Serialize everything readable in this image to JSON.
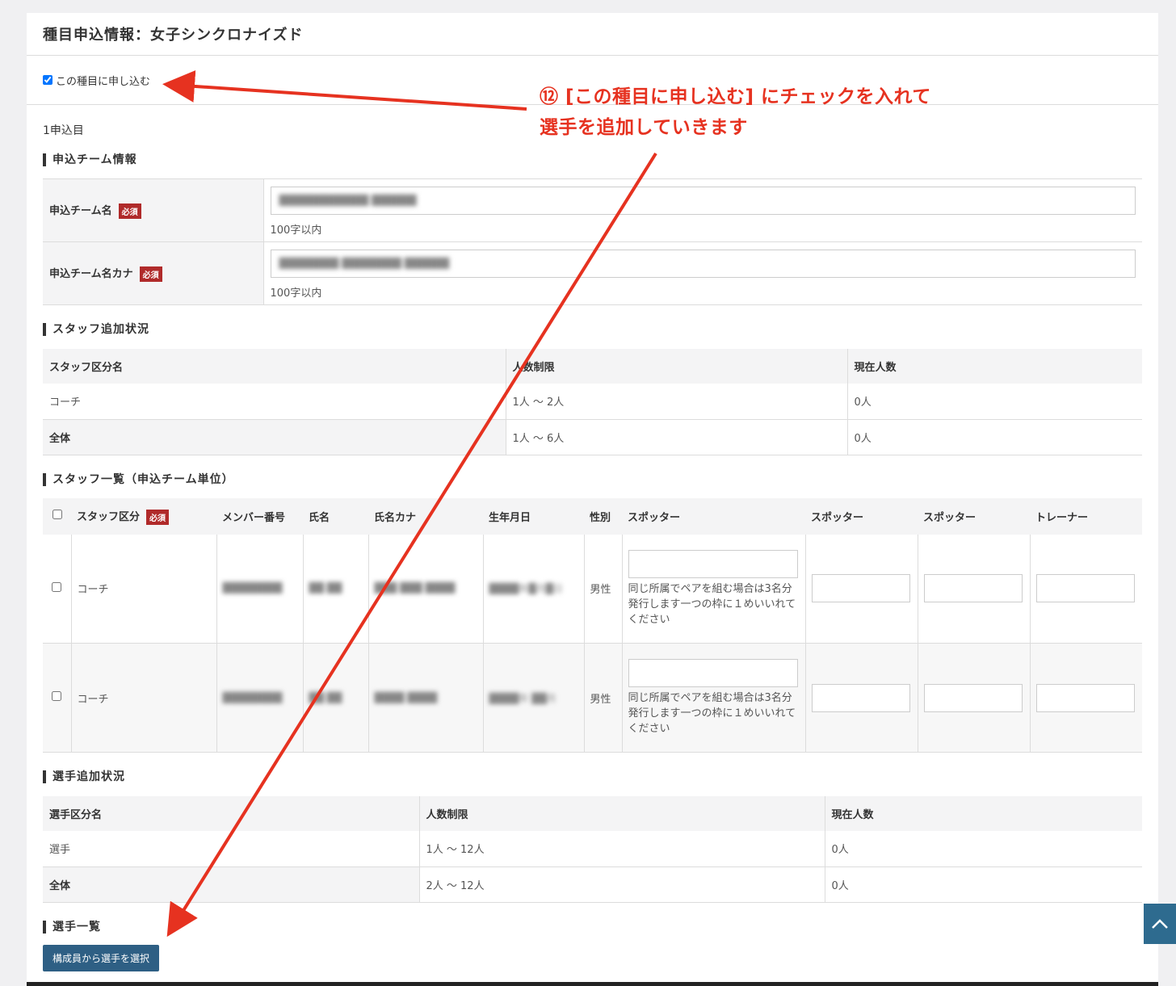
{
  "header": {
    "title": "種目申込情報：女子シンクロナイズド"
  },
  "apply": {
    "label": "この種目に申し込む",
    "checked": true
  },
  "entry": {
    "label": "1申込目"
  },
  "team_info": {
    "section_title": "申込チーム情報",
    "required_badge": "必須",
    "team_name_label": "申込チーム名",
    "team_name_value": "████████████ ██████",
    "team_name_hint": "100字以内",
    "team_kana_label": "申込チーム名カナ",
    "team_kana_value": "████████ ████████ ██████",
    "team_kana_hint": "100字以内"
  },
  "staff_status": {
    "section_title": "スタッフ追加状況",
    "headers": [
      "スタッフ区分名",
      "人数制限",
      "現在人数"
    ],
    "rows": [
      {
        "name": "コーチ",
        "limit": "1人 〜 2人",
        "current": "0人"
      }
    ],
    "total": {
      "name": "全体",
      "limit": "1人 〜 6人",
      "current": "0人"
    }
  },
  "staff_list": {
    "section_title": "スタッフ一覧（申込チーム単位）",
    "headers": [
      "スタッフ区分",
      "メンバー番号",
      "氏名",
      "氏名カナ",
      "生年月日",
      "性別",
      "スポッター",
      "スポッター",
      "スポッター",
      "トレーナー"
    ],
    "required_badge": "必須",
    "spotter_note": "同じ所属でペアを組む場合は3名分発行します一つの枠に１めいいれてください",
    "rows": [
      {
        "category": "コーチ",
        "member_no": "████████",
        "name": "██ ██",
        "kana": "███ ███ ████",
        "birth": "████年█月█日",
        "gender": "男性"
      },
      {
        "category": "コーチ",
        "member_no": "████████",
        "name": "██ ██",
        "kana": "████ ████",
        "birth": "████年 ██月",
        "gender": "男性"
      }
    ]
  },
  "player_status": {
    "section_title": "選手追加状況",
    "headers": [
      "選手区分名",
      "人数制限",
      "現在人数"
    ],
    "rows": [
      {
        "name": "選手",
        "limit": "1人 〜 12人",
        "current": "0人"
      }
    ],
    "total": {
      "name": "全体",
      "limit": "2人 〜 12人",
      "current": "0人"
    }
  },
  "player_list": {
    "section_title": "選手一覧",
    "select_button": "構成員から選手を選択"
  },
  "annotation": {
    "line1": "⑫ [この種目に申し込む] にチェックを入れて",
    "line2": "選手を追加していきます",
    "color": "#e63220"
  }
}
